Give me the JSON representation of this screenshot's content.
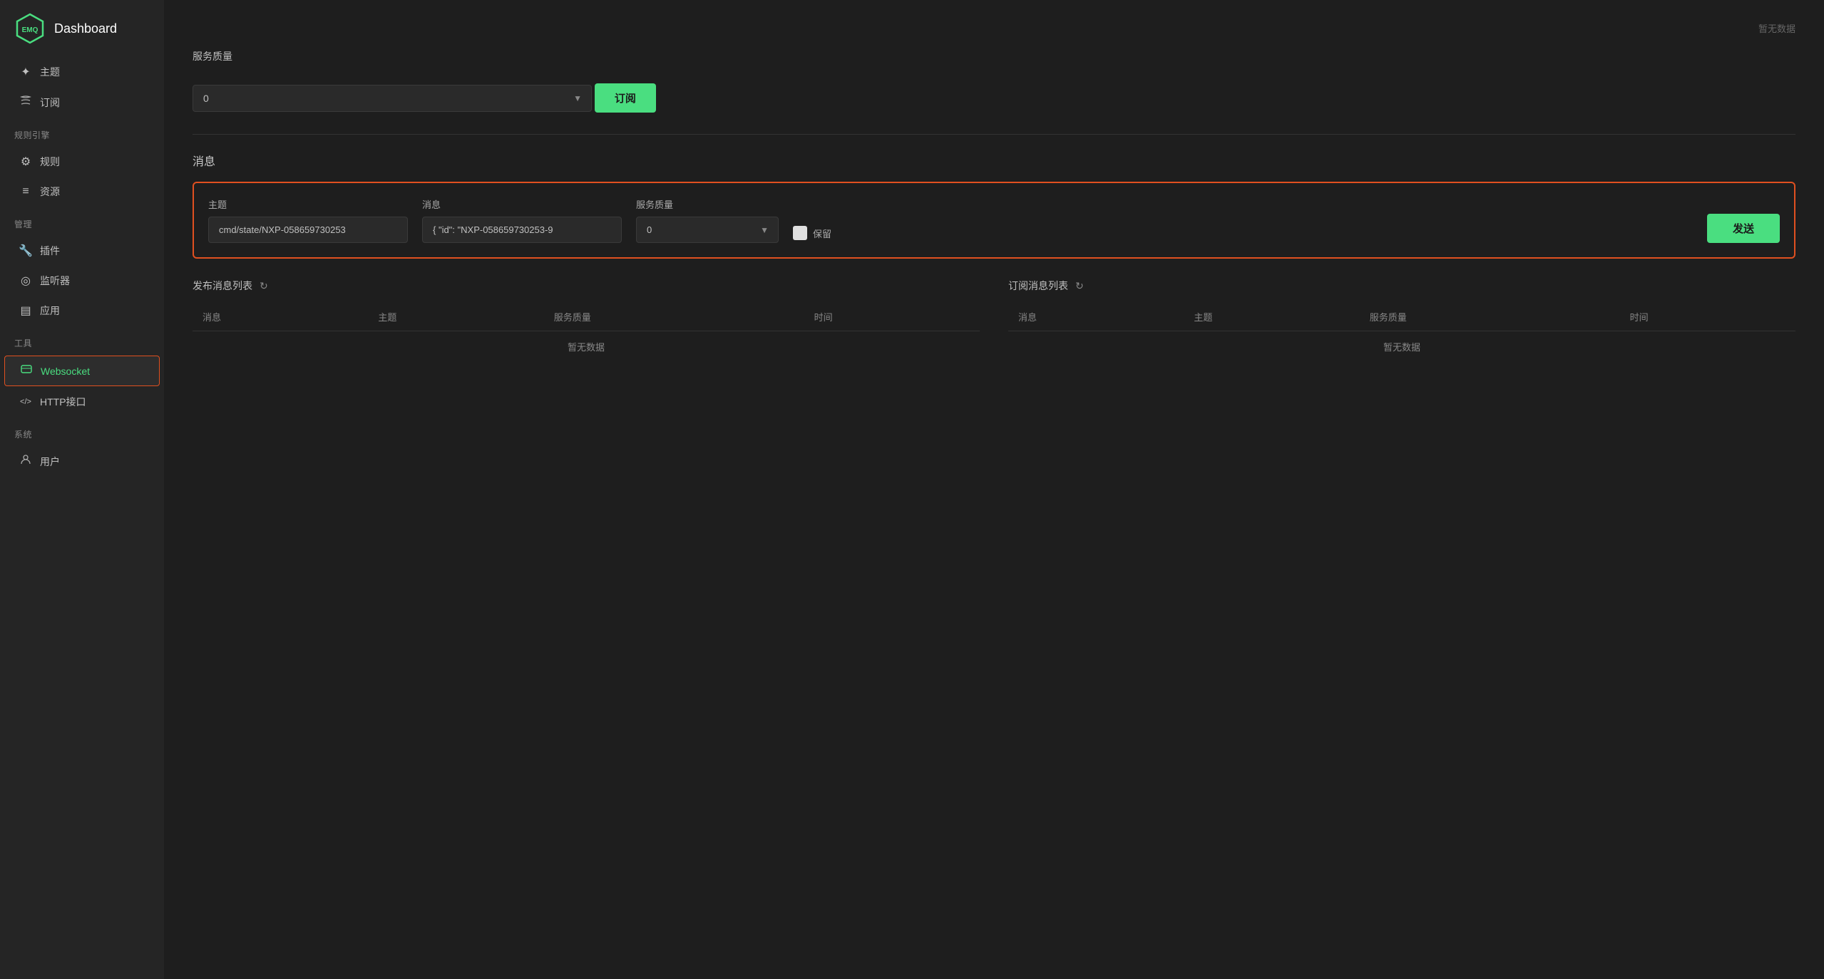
{
  "app": {
    "logo_text": "EMQ",
    "title": "Dashboard"
  },
  "sidebar": {
    "sections": [
      {
        "items": [
          {
            "id": "topic",
            "label": "主题",
            "icon": "✦"
          },
          {
            "id": "subscribe",
            "label": "订阅",
            "icon": "📡"
          }
        ]
      },
      {
        "label": "规则引擎",
        "items": [
          {
            "id": "rules",
            "label": "规则",
            "icon": "⚙"
          },
          {
            "id": "resources",
            "label": "资源",
            "icon": "≡"
          }
        ]
      },
      {
        "label": "管理",
        "items": [
          {
            "id": "plugins",
            "label": "插件",
            "icon": "🔧"
          },
          {
            "id": "monitor",
            "label": "监听器",
            "icon": "◎"
          },
          {
            "id": "apps",
            "label": "应用",
            "icon": "▤"
          }
        ]
      },
      {
        "label": "工具",
        "items": [
          {
            "id": "websocket",
            "label": "Websocket",
            "icon": "☰",
            "active": true
          },
          {
            "id": "http",
            "label": "HTTP接口",
            "icon": "</>"
          }
        ]
      },
      {
        "label": "系统",
        "items": [
          {
            "id": "users",
            "label": "用户",
            "icon": "👤"
          }
        ]
      }
    ]
  },
  "subscribe_section": {
    "qos_label": "服务质量",
    "qos_value": "0",
    "no_data_text": "暂无数据",
    "btn_label": "订阅"
  },
  "message_section": {
    "title": "消息",
    "compose": {
      "topic_label": "主题",
      "topic_value": "cmd/state/NXP-058659730253",
      "message_label": "消息",
      "message_value": "{ \"id\": \"NXP-058659730253-9",
      "qos_label": "服务质量",
      "qos_value": "0",
      "retain_label": "保留",
      "send_btn": "发送"
    },
    "publish_table": {
      "title": "发布消息列表",
      "columns": [
        "消息",
        "主题",
        "服务质量",
        "时间"
      ],
      "no_data": "暂无数据"
    },
    "subscribe_table": {
      "title": "订阅消息列表",
      "columns": [
        "消息",
        "主题",
        "服务质量",
        "时间"
      ],
      "no_data": "暂无数据"
    }
  }
}
